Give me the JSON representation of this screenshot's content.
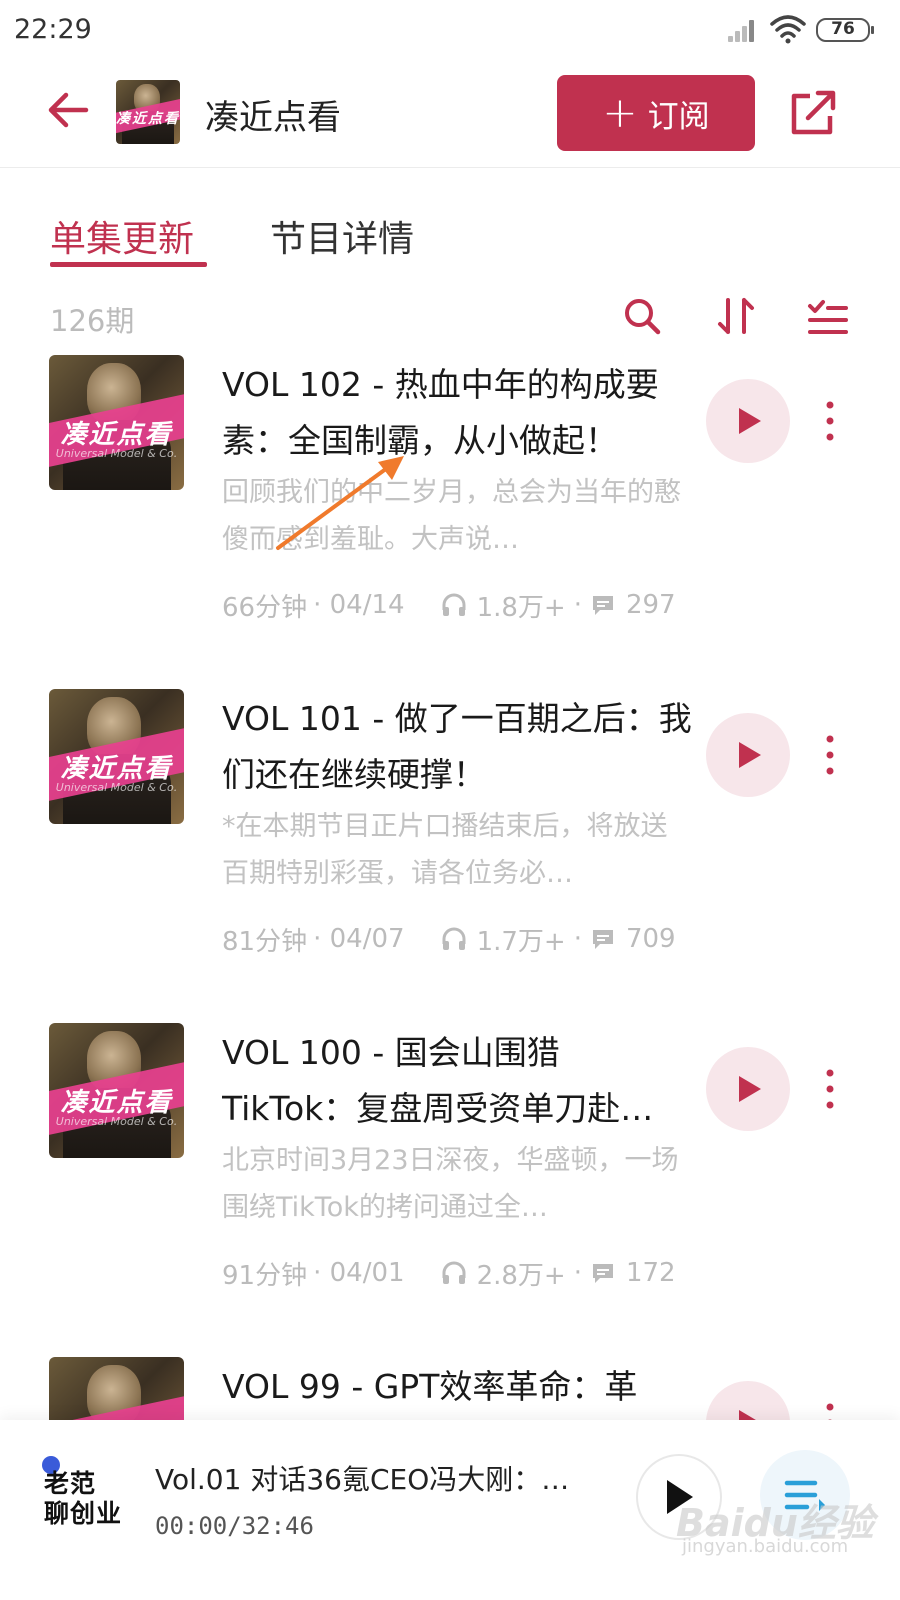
{
  "status_bar": {
    "time": "22:29",
    "battery": "76"
  },
  "header": {
    "title": "凑近点看",
    "subscribe_label": "订阅",
    "subscribe_plus": "+"
  },
  "cover": {
    "title": "凑近点看",
    "subtitle": "Universal Model & Co."
  },
  "tabs": [
    {
      "label": "单集更新",
      "active": true
    },
    {
      "label": "节目详情",
      "active": false
    }
  ],
  "list_header": {
    "episode_count": "126期"
  },
  "episodes": [
    {
      "title": "VOL 102 - 热血中年的构成要素：全国制霸，从小做起！",
      "description": "回顾我们的中二岁月，总会为当年的憨傻而感到羞耻。大声说…",
      "duration": "66分钟",
      "date": "· 04/14",
      "plays": "1.8万+",
      "dot": "·",
      "comments": "297"
    },
    {
      "title": "VOL 101 - 做了一百期之后：我们还在继续硬撑！",
      "description": "*在本期节目正片口播结束后，将放送百期特别彩蛋，请各位务必…",
      "duration": "81分钟",
      "date": "· 04/07",
      "plays": "1.7万+",
      "dot": "·",
      "comments": "709"
    },
    {
      "title": "VOL 100 - 国会山围猎TikTok：复盘周受资单刀赴…",
      "description": "北京时间3月23日深夜，华盛顿，一场围绕TikTok的拷问通过全…",
      "duration": "91分钟",
      "date": "· 04/01",
      "plays": "2.8万+",
      "dot": "·",
      "comments": "172"
    },
    {
      "title": "VOL 99 - GPT效率革命：革",
      "description": "",
      "duration": "",
      "date": "",
      "plays": "",
      "dot": "",
      "comments": ""
    }
  ],
  "mini_player": {
    "logo_line1": "老范",
    "logo_line2": "聊创业",
    "title": "Vol.01 对话36氪CEO冯大刚：…",
    "time": "00:00/32:46"
  },
  "watermark": {
    "text": "Baidu经验",
    "sub": "jingyan.baidu.com"
  },
  "colors": {
    "accent": "#c0314f",
    "muted": "#bbbbbb",
    "play_bg": "#f7e6ea",
    "cover_pink": "#e8408f"
  }
}
